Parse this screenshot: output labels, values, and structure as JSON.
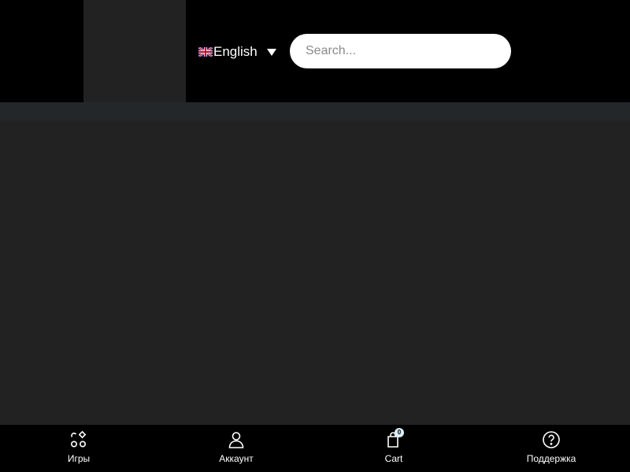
{
  "header": {
    "language": {
      "label": "English",
      "flag_icon": "uk-flag-icon",
      "caret_icon": "caret-down-icon"
    },
    "search": {
      "placeholder": "Search...",
      "value": ""
    }
  },
  "bottom_nav": {
    "items": [
      {
        "label": "Игры",
        "icon": "games-icon"
      },
      {
        "label": "Аккаунт",
        "icon": "user-icon"
      },
      {
        "label": "Cart",
        "icon": "shopping-bag-icon",
        "badge": "0"
      },
      {
        "label": "Поддержка",
        "icon": "help-circle-icon"
      }
    ]
  },
  "colors": {
    "header_bg": "#000000",
    "page_bg": "#222222",
    "strip_bg": "#24272a",
    "nav_bg": "#000000",
    "badge_bg": "#d9eef6"
  }
}
